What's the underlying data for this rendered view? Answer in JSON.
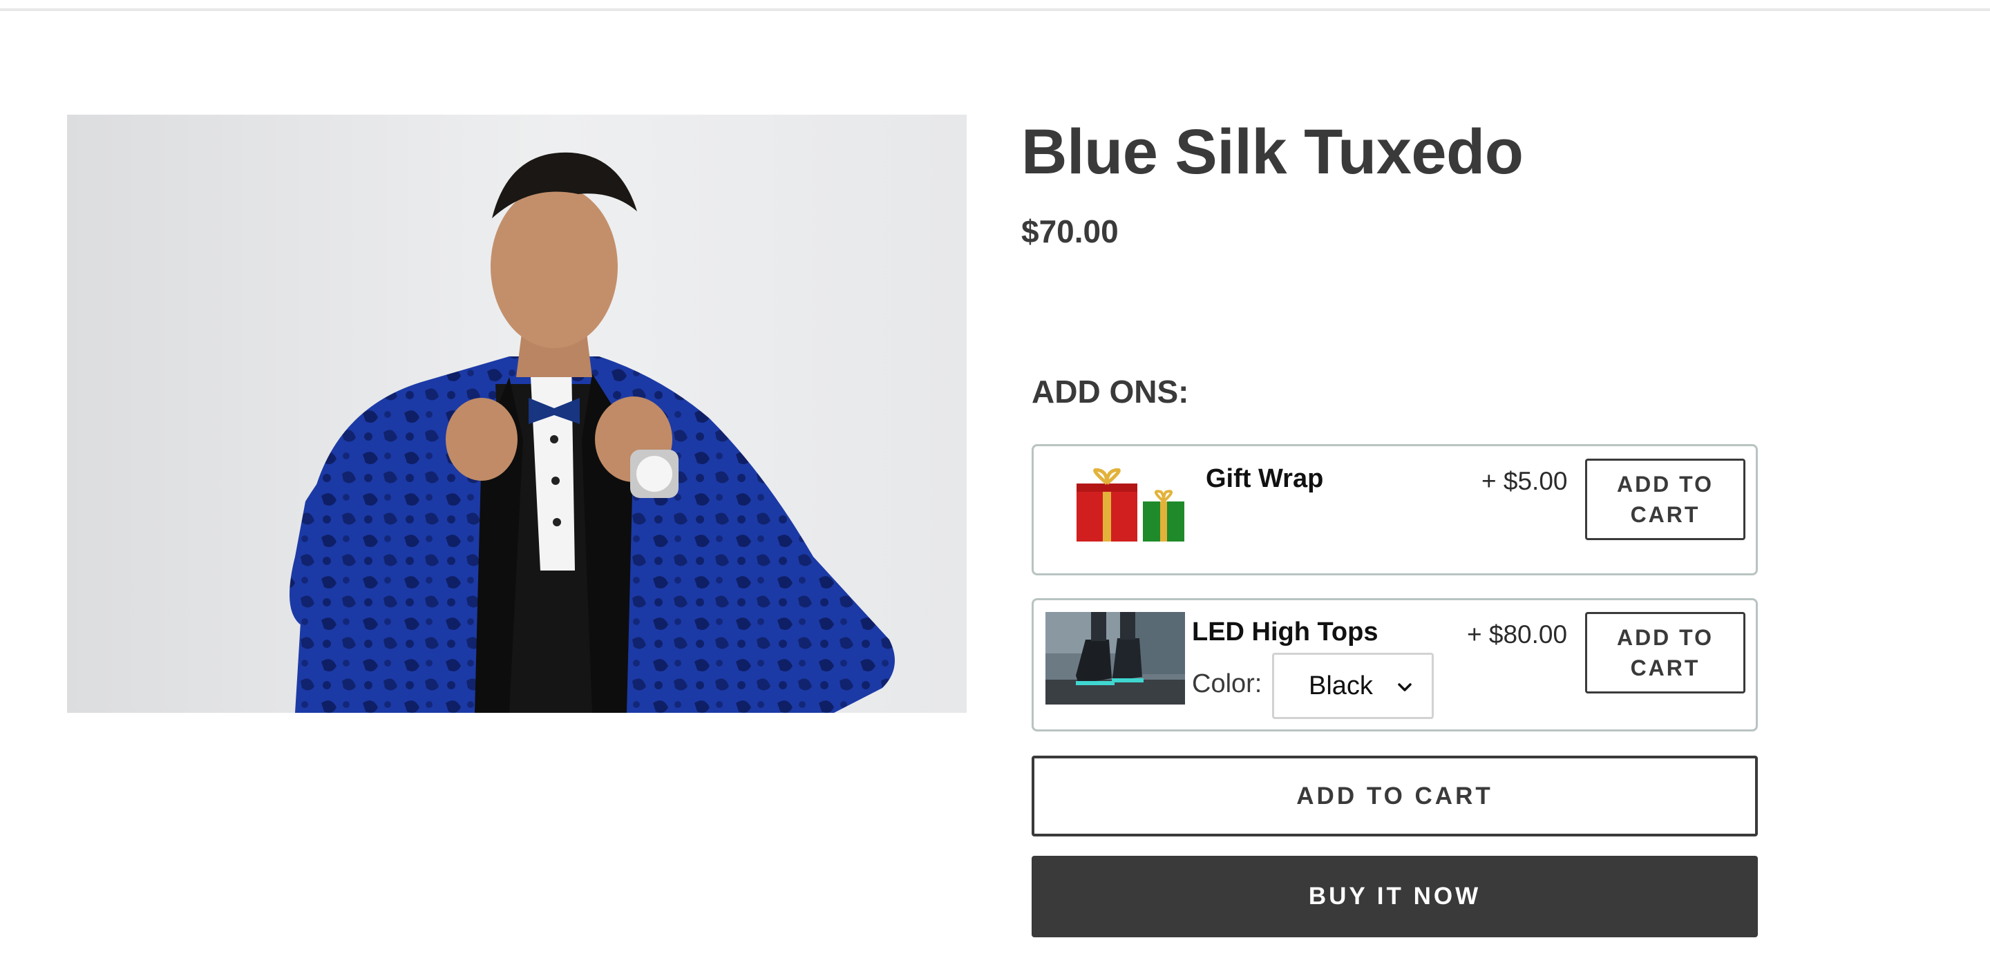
{
  "product": {
    "title": "Blue Silk Tuxedo",
    "price": "$70.00",
    "image_alt": "Man in blue silk tuxedo adjusting bow tie"
  },
  "addons": {
    "heading": "ADD ONS:",
    "items": [
      {
        "name": "Gift Wrap",
        "price": "+ $5.00",
        "button_label": "ADD TO CART",
        "thumb_icon": "gift-boxes-icon"
      },
      {
        "name": "LED High Tops",
        "price": "+ $80.00",
        "button_label": "ADD TO CART",
        "option_label": "Color:",
        "option_selected": "Black",
        "thumb_icon": "sneakers-photo"
      }
    ]
  },
  "actions": {
    "add_to_cart": "ADD TO CART",
    "buy_now": "BUY IT NOW"
  },
  "colors": {
    "text": "#3a3a3a",
    "buy_now_bg": "#3a3a3a",
    "card_border": "#b8c4c2",
    "jacket_blue": "#1f3fa8"
  }
}
